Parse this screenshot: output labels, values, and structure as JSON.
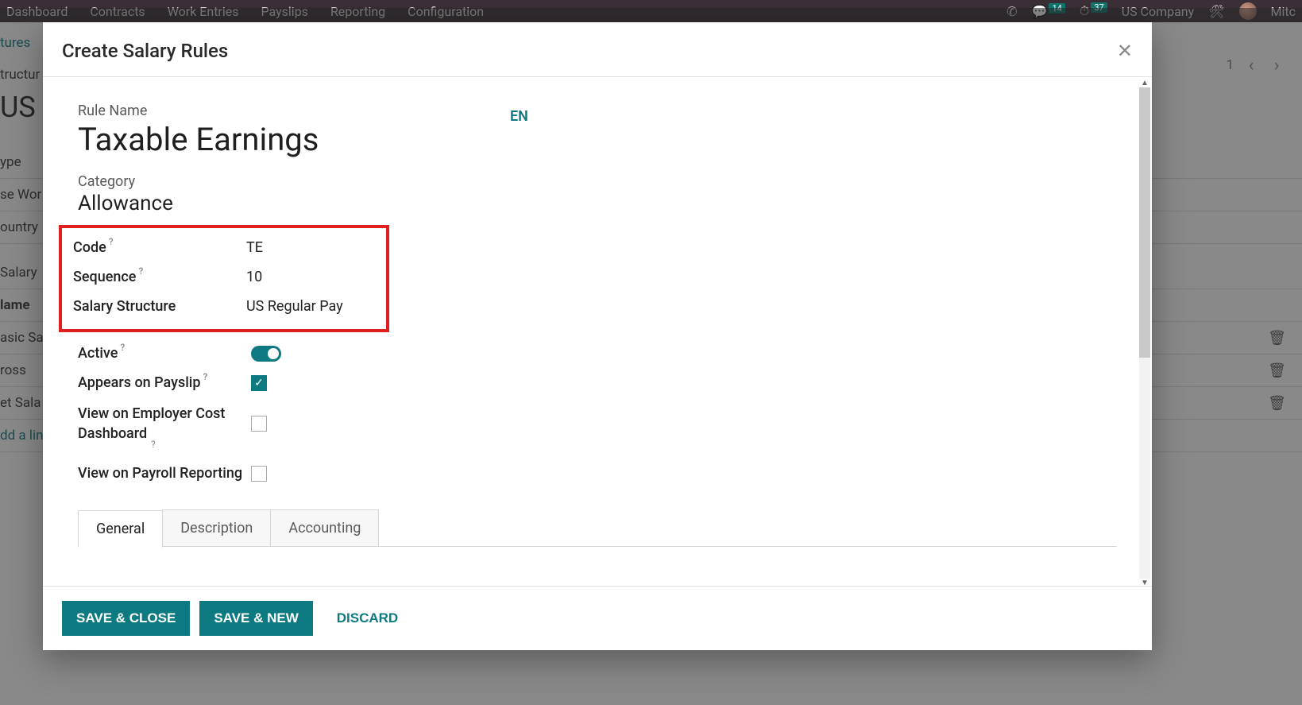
{
  "topbar": {
    "nav": [
      "Dashboard",
      "Contracts",
      "Work Entries",
      "Payslips",
      "Reporting",
      "Configuration"
    ],
    "msg_count": "14",
    "clock_count": "37",
    "company": "US Company",
    "user": "Mitc"
  },
  "bg": {
    "breadcrumb": "tures",
    "title": "US",
    "labels": {
      "structure": "tructur",
      "type": "ype",
      "work": "se Wor",
      "country": "ountry",
      "salary": "Salary",
      "name_col": "lame",
      "rows": [
        "asic Sa",
        "ross",
        "et Sala"
      ],
      "add": "dd a lin"
    },
    "pager": "1"
  },
  "modal": {
    "title": "Create Salary Rules",
    "rule_name_label": "Rule Name",
    "rule_name_value": "Taxable Earnings",
    "lang": "EN",
    "category_label": "Category",
    "category_value": "Allowance",
    "code_label": "Code",
    "code_value": "TE",
    "sequence_label": "Sequence",
    "sequence_value": "10",
    "salary_structure_label": "Salary Structure",
    "salary_structure_value": "US Regular Pay",
    "active_label": "Active",
    "appears_label": "Appears on Payslip",
    "employer_cost_label": "View on Employer Cost Dashboard",
    "payroll_reporting_label": "View on Payroll Reporting",
    "tabs": {
      "general": "General",
      "description": "Description",
      "accounting": "Accounting"
    },
    "footer": {
      "save_close": "SAVE & CLOSE",
      "save_new": "SAVE & NEW",
      "discard": "DISCARD"
    }
  }
}
